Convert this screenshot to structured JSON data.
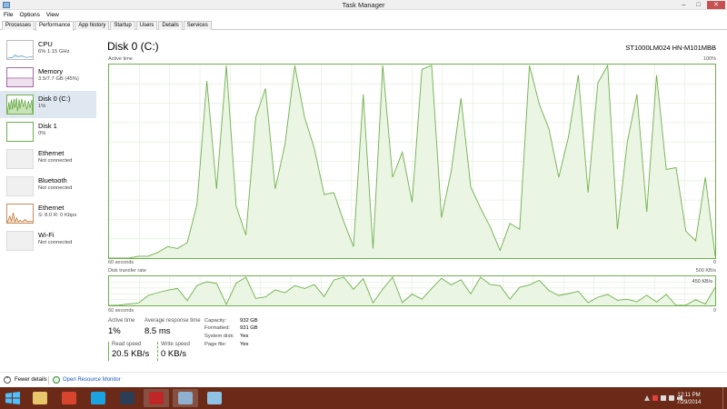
{
  "window": {
    "title": "Task Manager",
    "min": "–",
    "max": "□",
    "close": "✕"
  },
  "menu": [
    "File",
    "Options",
    "View"
  ],
  "tabs": [
    "Processes",
    "Performance",
    "App history",
    "Startup",
    "Users",
    "Details",
    "Services"
  ],
  "sidebar": [
    {
      "label": "CPU",
      "sub": "6% 1.15 GHz",
      "color": "#4a8cc7"
    },
    {
      "label": "Memory",
      "sub": "3.5/7.7 GB (45%)",
      "color": "#8b3a8b"
    },
    {
      "label": "Disk 0 (C:)",
      "sub": "1%",
      "color": "#4d9a2a"
    },
    {
      "label": "Disk 1",
      "sub": "0%",
      "color": "#4d9a2a"
    },
    {
      "label": "Ethernet",
      "sub": "Not connected",
      "color": "#bbbbbb"
    },
    {
      "label": "Bluetooth",
      "sub": "Not connected",
      "color": "#bbbbbb"
    },
    {
      "label": "Ethernet",
      "sub": "S: 8.0 R: 0 Kbps",
      "color": "#b5651d"
    },
    {
      "label": "Wi-Fi",
      "sub": "Not connected",
      "color": "#bbbbbb"
    }
  ],
  "main": {
    "title": "Disk 0 (C:)",
    "model": "ST1000LM024 HN-M101MBB",
    "active_time_label": "Active time",
    "active_time_max": "100%",
    "seconds_label": "60 seconds",
    "zero": "0",
    "transfer_label": "Disk transfer rate",
    "transfer_max": "500 KB/s",
    "transfer_inner": "450 KB/s"
  },
  "active_time_series": [
    0,
    0,
    0,
    1,
    1,
    3,
    6,
    5,
    8,
    28,
    92,
    36,
    100,
    27,
    12,
    73,
    88,
    36,
    59,
    100,
    73,
    57,
    33,
    34,
    19,
    6,
    85,
    5,
    100,
    42,
    55,
    29,
    98,
    100,
    21,
    45,
    83,
    37,
    26,
    16,
    4,
    18,
    15,
    100,
    80,
    67,
    42,
    63,
    95,
    34,
    91,
    100,
    15,
    60,
    85,
    24,
    95,
    46,
    47,
    14,
    9,
    42,
    1
  ],
  "transfer_series": [
    0,
    1,
    5,
    8,
    35,
    45,
    54,
    60,
    17,
    71,
    84,
    78,
    4,
    79,
    100,
    25,
    30,
    55,
    45,
    70,
    60,
    74,
    31,
    90,
    100,
    57,
    95,
    9,
    58,
    100,
    10,
    40,
    22,
    60,
    96,
    73,
    91,
    41,
    100,
    74,
    70,
    22,
    64,
    73,
    89,
    53,
    35,
    42,
    50,
    10,
    29,
    39,
    18,
    22,
    13,
    36,
    12,
    39,
    0,
    1,
    20,
    5,
    64
  ],
  "stats": {
    "active_time_label": "Active time",
    "active_time": "1%",
    "avg_response_label": "Average response time",
    "avg_response": "8.5 ms",
    "read_speed_label": "Read speed",
    "read_speed": "20.5 KB/s",
    "write_speed_label": "Write speed",
    "write_speed": "0 KB/s"
  },
  "info": [
    {
      "k": "Capacity:",
      "v": "932 GB"
    },
    {
      "k": "Formatted:",
      "v": "931 GB"
    },
    {
      "k": "System disk:",
      "v": "Yes"
    },
    {
      "k": "Page file:",
      "v": "Yes"
    }
  ],
  "footer": {
    "fewer": "Fewer details",
    "resmon": "Open Resource Monitor"
  },
  "taskbar": {
    "items": [
      {
        "name": "file-explorer-icon",
        "color": "#e8c66b",
        "open": false
      },
      {
        "name": "chrome-icon",
        "color": "#d9442f",
        "open": false
      },
      {
        "name": "skype-icon",
        "color": "#1aa3e0",
        "open": false
      },
      {
        "name": "steam-icon",
        "color": "#2a3f55",
        "open": false
      },
      {
        "name": "filezilla-icon",
        "color": "#bf2626",
        "open": true
      },
      {
        "name": "task-manager-icon",
        "color": "#8fb0cf",
        "open": true
      },
      {
        "name": "app-icon",
        "color": "#8fc3e6",
        "open": false
      }
    ],
    "time": "12:11 PM",
    "date": "7/29/2014"
  }
}
